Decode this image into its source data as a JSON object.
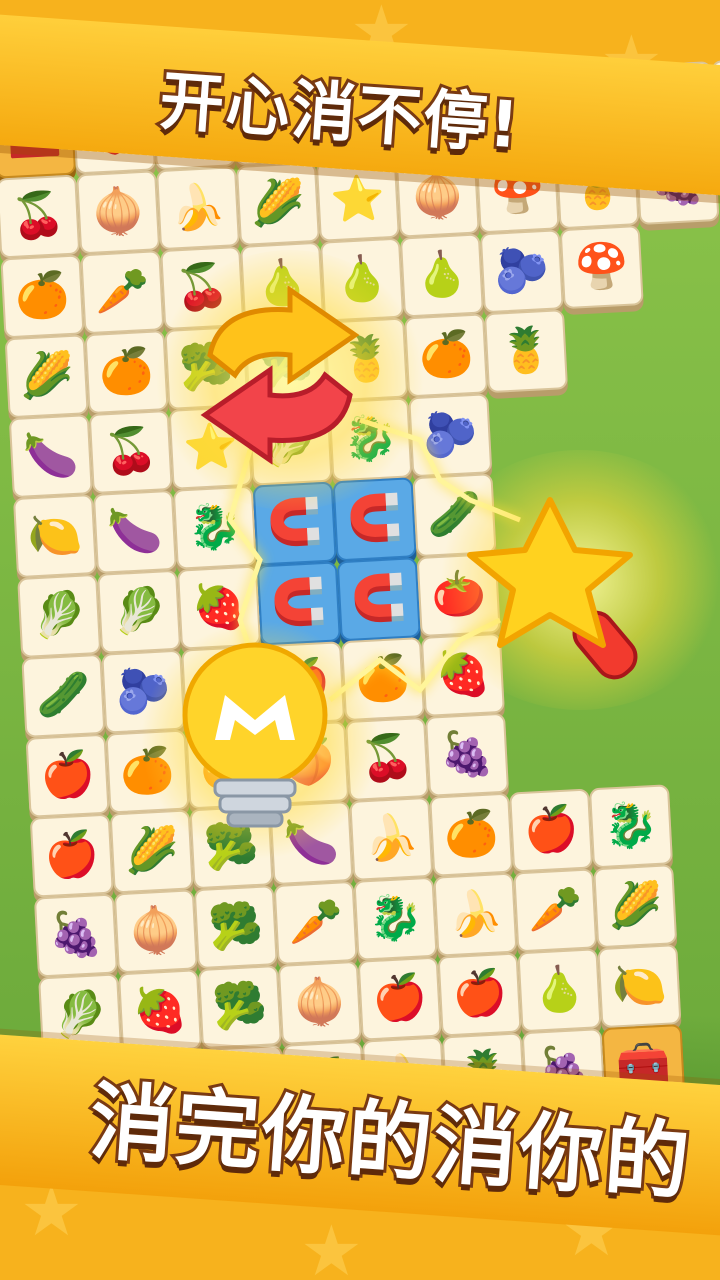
{
  "headline_top": "开心消不停!",
  "headline_bottom": "消完你的消你的",
  "colors": {
    "banner": "#f7b21d",
    "text_stroke": "#7a3a12",
    "tile": "#fdf4dd",
    "magnet_tile": "#5aa9e6"
  },
  "boosters": [
    {
      "name": "shuffle-booster",
      "icon": "shuffle-arrows-icon"
    },
    {
      "name": "star-wand-booster",
      "icon": "star-wand-icon"
    },
    {
      "name": "hint-bulb-booster",
      "icon": "lightbulb-icon"
    },
    {
      "name": "magnet-tiles",
      "icon": "magnet-icon"
    }
  ],
  "tiles": [
    [
      "🧰",
      "🍑",
      "🍇",
      "🍋",
      "🍌",
      "🌽",
      "⭐",
      "🧅",
      "🍄",
      "🍍"
    ],
    [
      "🍒",
      "🧅",
      "🍌",
      "🌽",
      "⭐",
      "🧅",
      "🍄",
      "🍍",
      "🍇"
    ],
    [
      "🍊",
      "🥕",
      "🍒",
      "🍐",
      "🍐",
      "🍐",
      "🫐",
      "🍄"
    ],
    [
      "🌽",
      "🍊",
      "🥦",
      "🥦",
      "🍍",
      "🍊",
      "🍍"
    ],
    [
      "🍆",
      "🍒",
      "⭐",
      "🥬",
      "🐉",
      "🫐"
    ],
    [
      "🍋",
      "🍆",
      "🐉",
      "🧲",
      "🧲",
      "🥒"
    ],
    [
      "🥬",
      "🥬",
      "🍓",
      "🧲",
      "🧲",
      "🍅"
    ],
    [
      "🥒",
      "🫐",
      "🥦",
      "🍎",
      "🍊",
      "🍓"
    ],
    [
      "🍎",
      "🍊",
      "🍊",
      "🍑",
      "🍒",
      "🍇"
    ],
    [
      "🍎",
      "🌽",
      "🥦",
      "🍆",
      "🍌",
      "🍊",
      "🍎",
      "🐉"
    ],
    [
      "🍇",
      "🧅",
      "🥦",
      "🥕",
      "🐉",
      "🍌",
      "🥕",
      "🌽"
    ],
    [
      "🥬",
      "🍓",
      "🥦",
      "🧅",
      "🍎",
      "🍎",
      "🍐",
      "🍋"
    ],
    [
      "🍋",
      "⭐",
      "🍓",
      "🍎",
      "🍌",
      "🍍",
      "🍇",
      "🧰"
    ]
  ]
}
